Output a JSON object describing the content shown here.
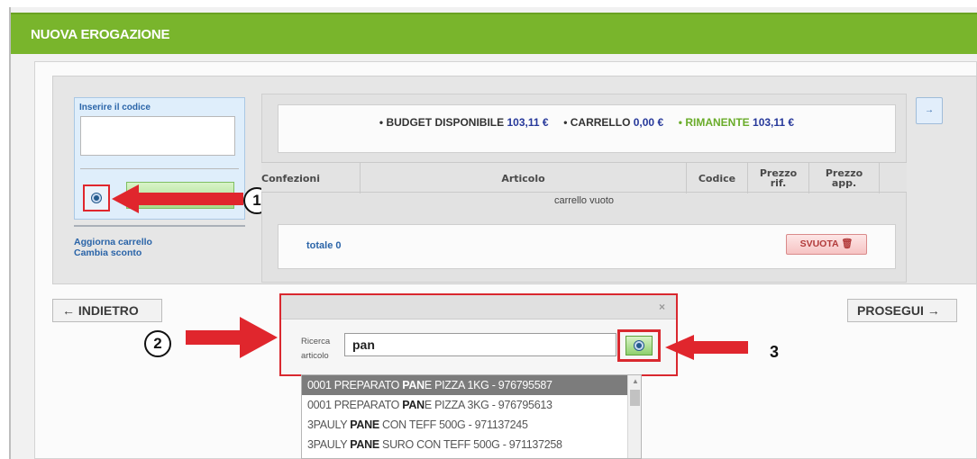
{
  "header": {
    "title": "NUOVA EROGAZIONE"
  },
  "code_panel": {
    "label": "Inserire il codice",
    "input_value": "",
    "links": [
      "Aggiorna carrello",
      "Cambia sconto"
    ]
  },
  "budget": {
    "disponibile_label": "• BUDGET DISPONIBILE",
    "disponibile_value": "103,11 €",
    "carrello_label": "• CARRELLO",
    "carrello_value": "0,00 €",
    "rimanente_label": "• RIMANENTE",
    "rimanente_value": "103,11 €"
  },
  "expand_button": {
    "label": "→"
  },
  "table": {
    "headers": [
      "Confezioni",
      "Articolo",
      "Codice",
      "Prezzo rif.",
      "Prezzo app."
    ],
    "empty_text": "carrello vuoto"
  },
  "totals": {
    "label": "totale 0",
    "clear_button": "SVUOTA 🗑"
  },
  "nav": {
    "back_label": "← INDIETRO",
    "next_label": "PROSEGUI →"
  },
  "popup": {
    "close": "×",
    "search_label": "Ricerca articolo",
    "search_value": "pan",
    "results": [
      {
        "pre": "0001 PREPARATO ",
        "match": "PAN",
        "post": "E PIZZA 1KG - 976795587",
        "selected": true
      },
      {
        "pre": "0001 PREPARATO ",
        "match": "PAN",
        "post": "E PIZZA 3KG - 976795613",
        "selected": false
      },
      {
        "pre": "3PAULY ",
        "match": "PANE",
        "post": " CON TEFF 500G - 971137245",
        "selected": false
      },
      {
        "pre": "3PAULY ",
        "match": "PANE",
        "post": " SURO CON TEFF 500G - 971137258",
        "selected": false
      }
    ]
  },
  "annotations": {
    "one": "1",
    "two": "2",
    "three": "3"
  },
  "colors": {
    "header_green": "#79b52c",
    "annotation_red": "#e0262d",
    "link_blue": "#2a64a8",
    "value_blue": "#26389a",
    "remaining_green": "#6aac2a"
  }
}
